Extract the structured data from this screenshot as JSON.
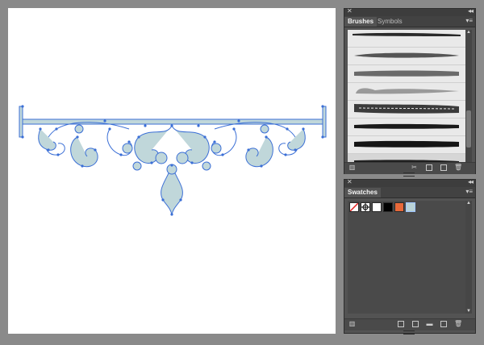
{
  "canvas": {
    "artboard_color": "#ffffff",
    "pasteboard_color": "#8a8a8a",
    "artwork_fill": "#c0d7da",
    "selection_color": "#3b6fd6"
  },
  "brushes_panel": {
    "close_glyph": "✕",
    "collapse_glyph": "◂◂",
    "tabs": [
      {
        "label": "Brushes",
        "active": true
      },
      {
        "label": "Symbols",
        "active": false
      }
    ],
    "menu_glyph": "▾≡",
    "brushes": [
      {
        "name": "brush-1",
        "style": "taper-thick"
      },
      {
        "name": "brush-2",
        "style": "tapered-gray"
      },
      {
        "name": "brush-3",
        "style": "smooth-gray"
      },
      {
        "name": "brush-4",
        "style": "cloud-gray"
      },
      {
        "name": "brush-5",
        "style": "chalk-black"
      },
      {
        "name": "brush-6",
        "style": "charcoal-black"
      },
      {
        "name": "brush-7",
        "style": "rough-black"
      },
      {
        "name": "brush-8",
        "style": "dry-black"
      }
    ],
    "footer_icons": [
      "libraries-icon",
      "remove-stroke-icon",
      "brush-options-icon",
      "new-brush-icon",
      "delete-icon"
    ]
  },
  "swatches_panel": {
    "close_glyph": "✕",
    "collapse_glyph": "◂◂",
    "tabs": [
      {
        "label": "Swatches",
        "active": true
      }
    ],
    "menu_glyph": "▾≡",
    "swatches": [
      {
        "name": "none",
        "color": "#ffffff"
      },
      {
        "name": "registration",
        "color": "#ffffff"
      },
      {
        "name": "white",
        "color": "#ffffff"
      },
      {
        "name": "black",
        "color": "#000000"
      },
      {
        "name": "orange",
        "color": "#e8693a"
      },
      {
        "name": "light-blue",
        "color": "#b9d2d6"
      }
    ],
    "footer_icons": [
      "libraries-icon",
      "swatch-kind-icon",
      "swatch-options-icon",
      "new-color-group-icon",
      "new-swatch-icon",
      "delete-icon"
    ]
  }
}
